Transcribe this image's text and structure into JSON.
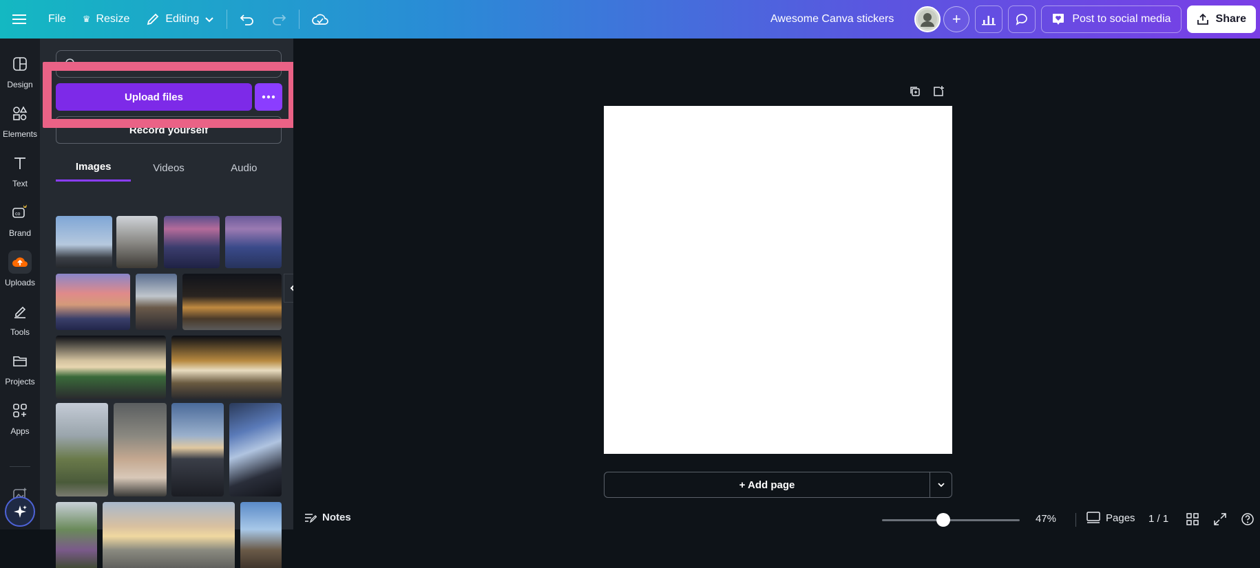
{
  "topbar": {
    "file_label": "File",
    "resize_label": "Resize",
    "editing_label": "Editing",
    "doc_title": "Awesome Canva stickers",
    "post_label": "Post to social media",
    "share_label": "Share"
  },
  "rail": {
    "items": [
      {
        "label": "Design",
        "icon": "layout-icon"
      },
      {
        "label": "Elements",
        "icon": "shapes-icon"
      },
      {
        "label": "Text",
        "icon": "text-icon"
      },
      {
        "label": "Brand",
        "icon": "brand-icon"
      },
      {
        "label": "Uploads",
        "icon": "cloud-upload-icon"
      },
      {
        "label": "Tools",
        "icon": "draw-icon"
      },
      {
        "label": "Projects",
        "icon": "folder-icon"
      },
      {
        "label": "Apps",
        "icon": "apps-icon"
      }
    ]
  },
  "panel": {
    "upload_label": "Upload files",
    "record_label": "Record yourself",
    "tabs": [
      "Images",
      "Videos",
      "Audio"
    ],
    "active_tab": "Images"
  },
  "canvas": {
    "add_page_label": "+ Add page"
  },
  "bottombar": {
    "notes_label": "Notes",
    "zoom": "47%",
    "pages_label": "Pages",
    "page_count": "1 / 1"
  },
  "colors": {
    "accent": "#8b3dff",
    "upload_button": "#7d2ae8",
    "highlight": "#ea6286"
  }
}
